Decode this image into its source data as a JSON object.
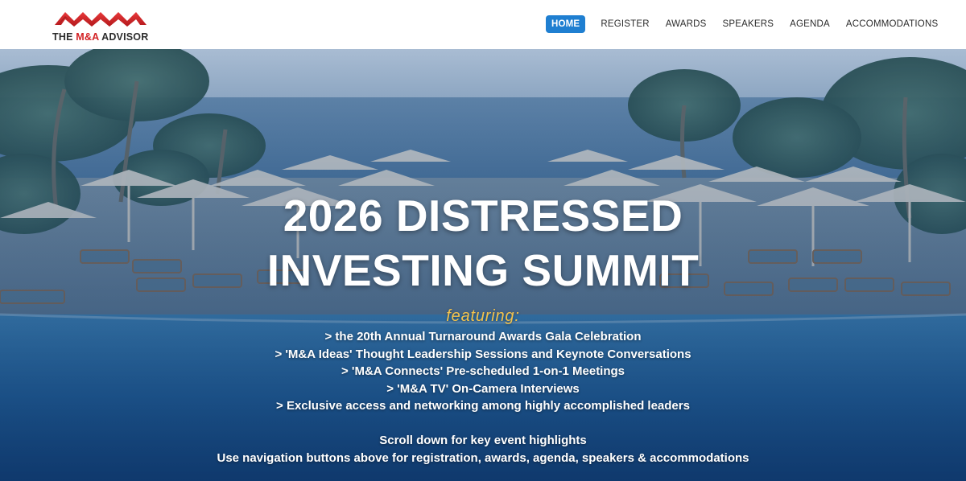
{
  "brand": {
    "logo_prefix": "THE ",
    "logo_accent": "M&A",
    "logo_suffix": " ADVISOR",
    "logo_icon": "mountains-logo-icon",
    "accent_color": "#d32124"
  },
  "nav": {
    "active_color": "#1f7fd1",
    "items": [
      {
        "label": "HOME",
        "active": true
      },
      {
        "label": "REGISTER",
        "active": false
      },
      {
        "label": "AWARDS",
        "active": false
      },
      {
        "label": "SPEAKERS",
        "active": false
      },
      {
        "label": "AGENDA",
        "active": false
      },
      {
        "label": "ACCOMMODATIONS",
        "active": false
      }
    ]
  },
  "hero": {
    "background": "resort pool with umbrellas and ocean",
    "title_line1": "2026 DISTRESSED",
    "title_line2": "INVESTING SUMMIT",
    "featuring": "featuring:",
    "featuring_color": "#f3c24d",
    "features": [
      "> the 20th Annual Turnaround Awards Gala Celebration",
      "> 'M&A Ideas' Thought Leadership Sessions and Keynote Conversations",
      "> 'M&A Connects' Pre-scheduled 1-on-1 Meetings",
      "> 'M&A TV' On-Camera Interviews",
      "> Exclusive access and networking among highly accomplished leaders"
    ],
    "note_scroll": "Scroll down for key event highlights",
    "note_nav": "Use navigation buttons above for registration, awards, agenda, speakers & accommodations"
  }
}
